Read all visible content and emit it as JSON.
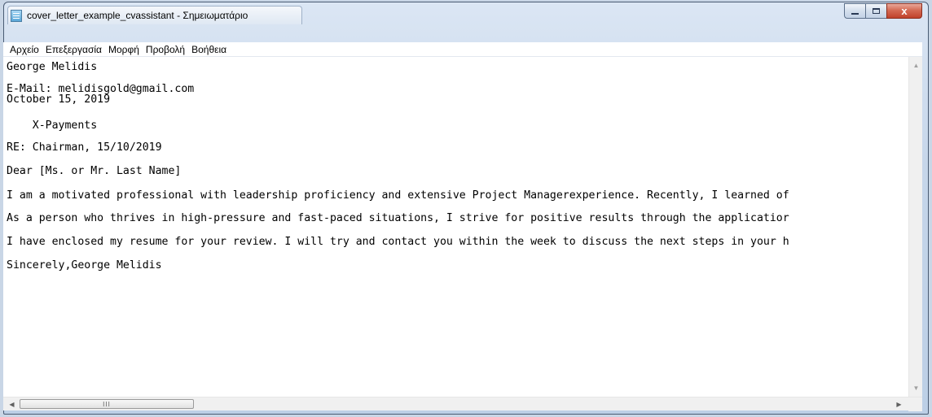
{
  "window": {
    "title": "cover_letter_example_cvassistant - Σημειωματάριο",
    "close_glyph": "x"
  },
  "menu": [
    "Αρχείο",
    "Επεξεργασία",
    "Μορφή",
    "Προβολή",
    "Βοήθεια"
  ],
  "document": {
    "lines": [
      "George Melidis",
      "",
      "E-Mail: melidisgold@gmail.com",
      "October 15, 2019",
      "",
      "    X-Payments",
      "",
      "RE: Chairman, 15/10/2019",
      "",
      "Dear [Ms. or Mr. Last Name]",
      "",
      "I am a motivated professional with leadership proficiency and extensive Project Managerexperience. Recently, I learned of",
      "",
      "As a person who thrives in high-pressure and fast-paced situations, I strive for positive results through the applicatior",
      "",
      "I have enclosed my resume for your review. I will try and contact you within the week to discuss the next steps in your h",
      "",
      "Sincerely,George Melidis"
    ]
  },
  "scrollbar": {
    "up_arrow": "▲",
    "down_arrow": "▼",
    "left_arrow": "◀",
    "right_arrow": "▶",
    "thumb_grip": "III"
  }
}
